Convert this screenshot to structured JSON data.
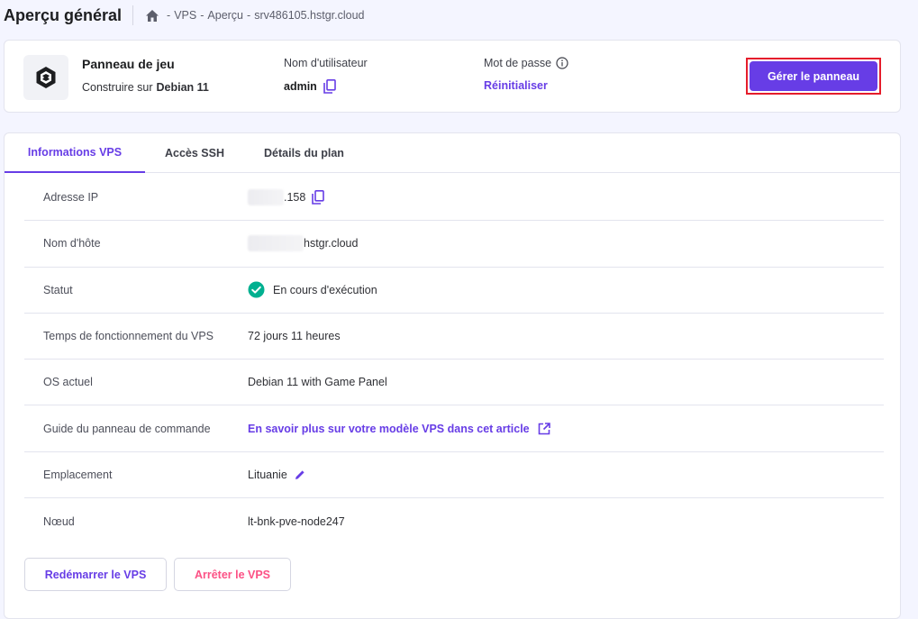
{
  "header": {
    "title": "Aperçu général",
    "breadcrumb": [
      "VPS",
      "Aperçu",
      "srv486105.hstgr.cloud"
    ],
    "separator": "-"
  },
  "summary": {
    "panel_title": "Panneau de jeu",
    "build_prefix": "Construire sur",
    "build_os": "Debian 11",
    "username_label": "Nom d'utilisateur",
    "username_value": "admin",
    "password_label": "Mot de passe",
    "reset_link": "Réinitialiser",
    "manage_button": "Gérer le panneau"
  },
  "tabs": [
    {
      "label": "Informations VPS",
      "active": true
    },
    {
      "label": "Accès SSH",
      "active": false
    },
    {
      "label": "Détails du plan",
      "active": false
    }
  ],
  "info": {
    "ip_label": "Adresse IP",
    "ip_value": ".158",
    "host_label": "Nom d'hôte",
    "host_value": "hstgr.cloud",
    "status_label": "Statut",
    "status_value": "En cours d'exécution",
    "uptime_label": "Temps de fonctionnement du VPS",
    "uptime_value": "72 jours 11 heures",
    "os_label": "OS actuel",
    "os_value": "Debian 11 with Game Panel",
    "guide_label": "Guide du panneau de commande",
    "guide_value": "En savoir plus sur votre modèle VPS dans cet article",
    "location_label": "Emplacement",
    "location_value": "Lituanie",
    "node_label": "Nœud",
    "node_value": "lt-bnk-pve-node247"
  },
  "actions": {
    "restart": "Redémarrer le VPS",
    "stop": "Arrêter le VPS"
  },
  "colors": {
    "accent": "#673de6",
    "danger": "#fc5185",
    "success": "#00b090",
    "highlight_border": "#e51d2b"
  }
}
